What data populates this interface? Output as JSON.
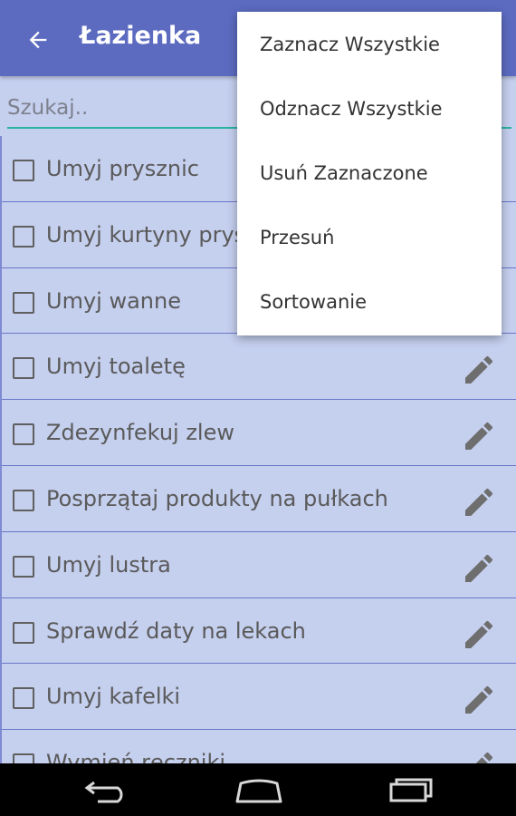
{
  "header": {
    "title": "Łazienka",
    "back_icon": "arrow-back-icon",
    "background": "#5c6bc0"
  },
  "search": {
    "placeholder": "Szukaj.."
  },
  "list": {
    "items": [
      {
        "label": "Umyj prysznic",
        "checked": false
      },
      {
        "label": "Umyj kurtyny prysznicowe",
        "checked": false
      },
      {
        "label": "Umyj wanne",
        "checked": false
      },
      {
        "label": "Umyj toaletę",
        "checked": false
      },
      {
        "label": "Zdezynfekuj zlew",
        "checked": false
      },
      {
        "label": "Posprzątaj produkty na pułkach",
        "checked": false
      },
      {
        "label": "Umyj lustra",
        "checked": false
      },
      {
        "label": "Sprawdź daty na lekach",
        "checked": false
      },
      {
        "label": "Umyj kafelki",
        "checked": false
      },
      {
        "label": "Wymień ręczniki",
        "checked": false
      }
    ],
    "edit_icon": "pencil-icon"
  },
  "menu": {
    "items": [
      "Zaznacz Wszystkie",
      "Odznacz Wszystkie",
      "Usuń Zaznaczone",
      "Przesuń",
      "Sortowanie"
    ]
  },
  "navbar": {
    "icons": [
      "back-icon",
      "home-icon",
      "recent-apps-icon"
    ]
  },
  "colors": {
    "list_background": "#c5cfee",
    "divider": "#6b77c9",
    "search_underline": "#2bb3a0"
  }
}
